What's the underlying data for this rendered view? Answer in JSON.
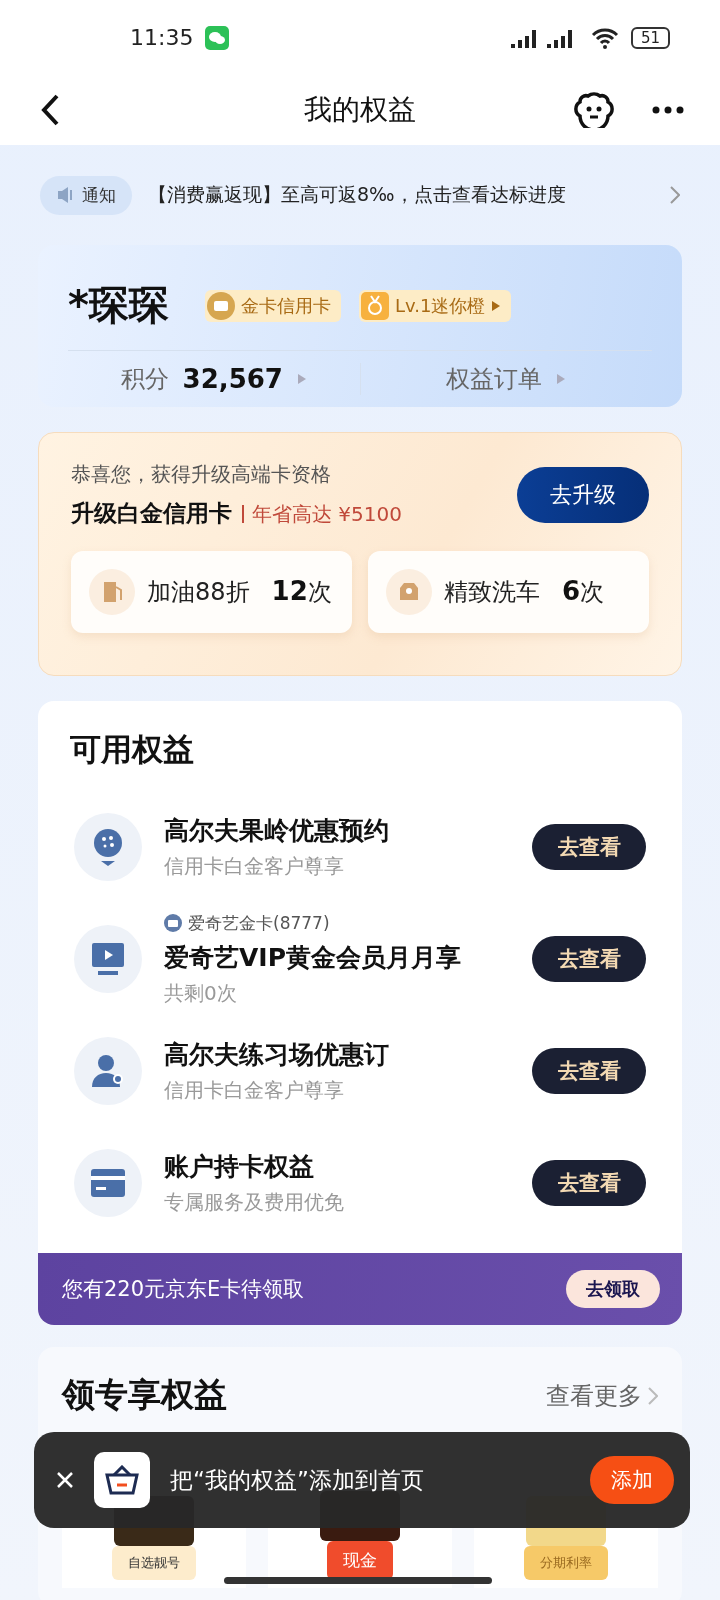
{
  "status_bar": {
    "time": "11:35",
    "battery": "51"
  },
  "nav": {
    "title": "我的权益"
  },
  "notice": {
    "tag": "通知",
    "text": "【消费赢返现】至高可返8‰，点击查看达标进度"
  },
  "profile": {
    "name": "*琛琛",
    "badges": [
      {
        "kind": "card",
        "label": "金卡信用卡"
      },
      {
        "kind": "level",
        "label": "Lv.1迷你橙"
      }
    ],
    "points_label": "积分",
    "points": "32,567",
    "orders": "权益订单"
  },
  "upgrade": {
    "intro": "恭喜您，获得升级高端卡资格",
    "title": "升级白金信用卡",
    "saving": "年省高达 ¥5100",
    "button": "去升级",
    "perks": [
      {
        "kind": "fuel",
        "name": "加油88折",
        "count": "12",
        "unit": "次"
      },
      {
        "kind": "carwash",
        "name": "精致洗车",
        "count": "6",
        "unit": "次"
      }
    ]
  },
  "available": {
    "title": "可用权益",
    "items": [
      {
        "kind": "golf",
        "title": "高尔夫果岭优惠预约",
        "subtitle": "信用卡白金客户尊享",
        "button": "去查看"
      },
      {
        "kind": "video",
        "card_tag": "爱奇艺金卡(8777)",
        "title": "爱奇艺VIP黄金会员月月享",
        "subtitle": "共剩0次",
        "button": "去查看"
      },
      {
        "kind": "person",
        "title": "高尔夫练习场优惠订",
        "subtitle": "信用卡白金客户尊享",
        "button": "去查看"
      },
      {
        "kind": "card",
        "title": "账户持卡权益",
        "subtitle": "专属服务及费用优免",
        "button": "去查看"
      }
    ]
  },
  "promo": {
    "text": "您有220元京东E卡待领取",
    "button": "去领取"
  },
  "exclusive": {
    "title": "领专享权益",
    "more": "查看更多",
    "tiles": [
      {
        "kind": "number",
        "label": "自选靓号"
      },
      {
        "kind": "cash",
        "label": "现金"
      },
      {
        "kind": "rate",
        "label": "分期利率"
      }
    ]
  },
  "toast": {
    "text": "把“我的权益”添加到首页",
    "button": "添加"
  }
}
